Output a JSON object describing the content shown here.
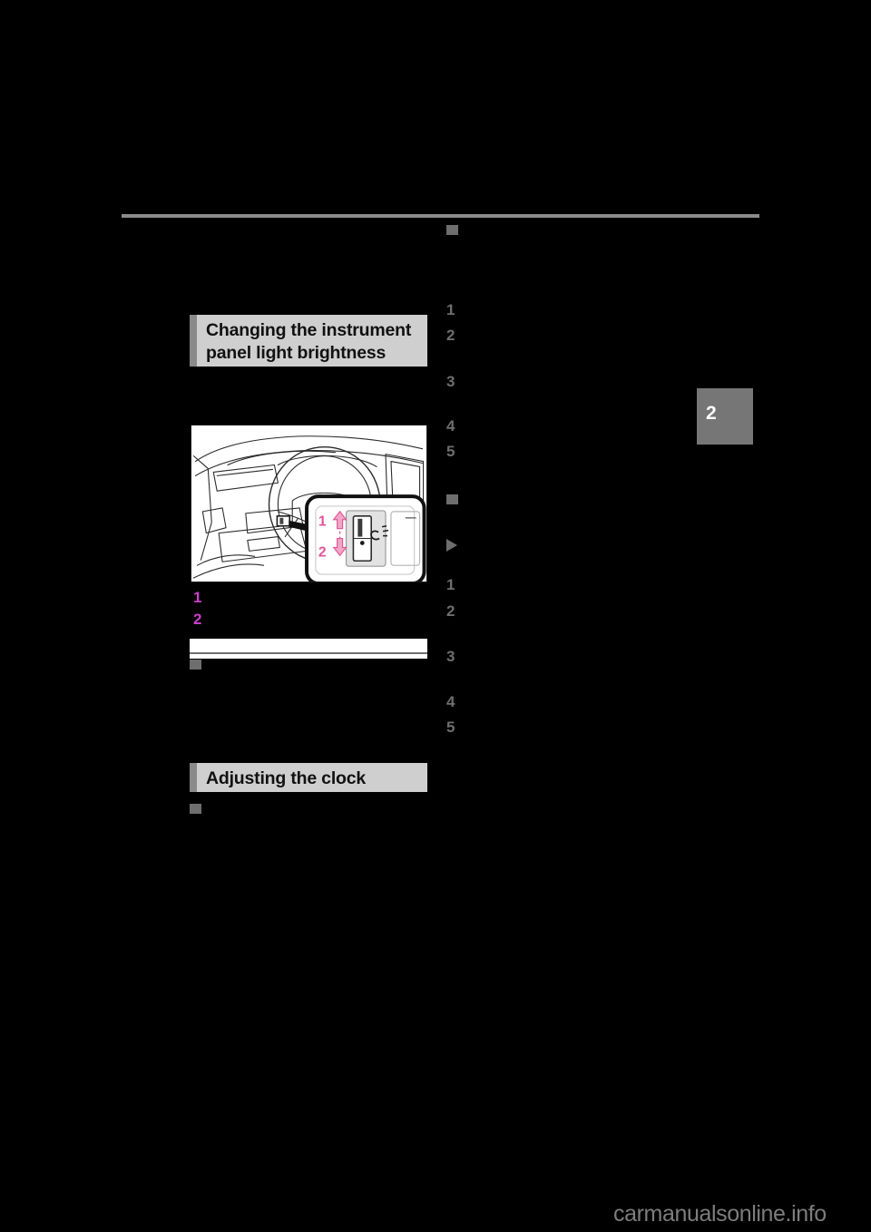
{
  "document": {
    "type": "vehicle-owners-manual-page",
    "background_color": "#000000",
    "chapter_tab": {
      "label": "2",
      "color": "#767676",
      "text_color": "#ffffff"
    }
  },
  "headings": {
    "brightness": "Changing the instrument panel light brightness",
    "clock": "Adjusting the clock",
    "bar_color": "#cfcfcf",
    "accent_color": "#8a8a8a"
  },
  "illustration": {
    "alt_name": "instrument-panel-dimmer-switch-location",
    "callout_labels": [
      "1",
      "2"
    ],
    "callout_color": "#e86aa6",
    "arrow_up_label": "1",
    "arrow_down_label": "2"
  },
  "left_column": {
    "steps": [
      {
        "number": "1",
        "color": "#cc3fcc"
      },
      {
        "number": "2",
        "color": "#cc3fcc"
      }
    ],
    "notice": {
      "title": "",
      "box_color": "#ffffff"
    },
    "bullets": [
      {
        "glyph": "square",
        "color": "#6e6e6e"
      },
      {
        "glyph": "square",
        "color": "#6e6e6e"
      }
    ]
  },
  "right_column": {
    "block_one": {
      "bullet": {
        "glyph": "square",
        "color": "#6e6e6e"
      },
      "steps": [
        {
          "number": "1"
        },
        {
          "number": "2"
        },
        {
          "number": "3"
        },
        {
          "number": "4"
        },
        {
          "number": "5"
        }
      ]
    },
    "block_two": {
      "bullet": {
        "glyph": "square",
        "color": "#6e6e6e"
      },
      "arrow": {
        "glyph": "triangle-right",
        "color": "#6e6e6e"
      },
      "steps": [
        {
          "number": "1"
        },
        {
          "number": "2"
        },
        {
          "number": "3"
        },
        {
          "number": "4"
        },
        {
          "number": "5"
        }
      ]
    }
  },
  "rule": {
    "color": "#8c8c8c"
  },
  "watermark": {
    "text": "carmanualsonline.info",
    "color": "#7d7d7d"
  }
}
